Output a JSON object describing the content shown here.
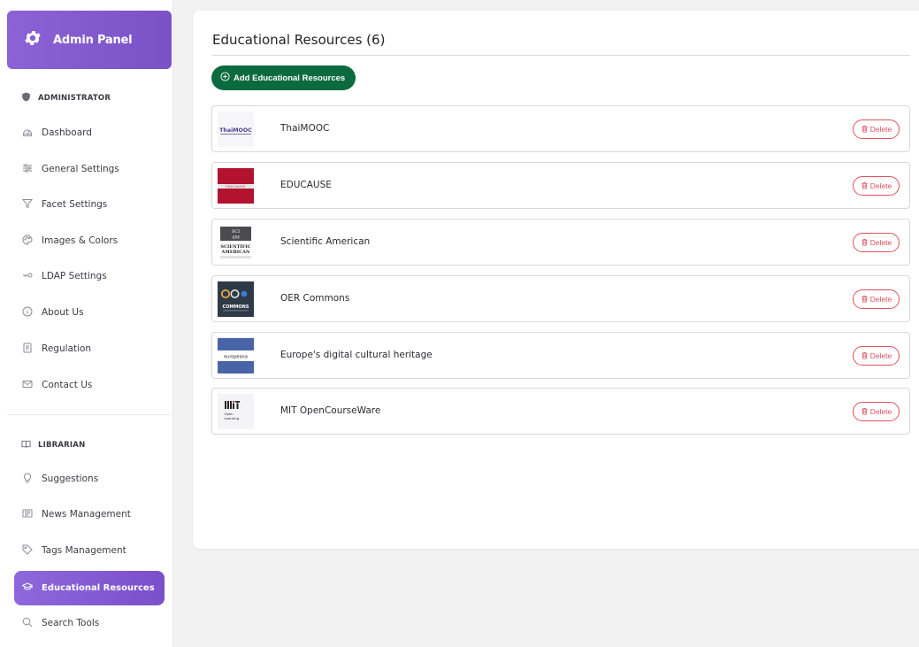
{
  "sidebar": {
    "brand_title": "Admin Panel",
    "sections": [
      {
        "title": "ADMINISTRATOR",
        "icon": "shield-icon"
      },
      {
        "title": "LIBRARIAN",
        "icon": "book-icon"
      }
    ],
    "items": [
      {
        "label": "Dashboard",
        "icon": "gauge-icon"
      },
      {
        "label": "General Settings",
        "icon": "sliders-icon"
      },
      {
        "label": "Facet Settings",
        "icon": "filter-icon"
      },
      {
        "label": "Images & Colors",
        "icon": "palette-icon"
      },
      {
        "label": "LDAP Settings",
        "icon": "key-icon"
      },
      {
        "label": "About Us",
        "icon": "info-icon"
      },
      {
        "label": "Regulation",
        "icon": "document-icon"
      },
      {
        "label": "Contact Us",
        "icon": "envelope-icon"
      },
      {
        "label": "Suggestions",
        "icon": "lightbulb-icon"
      },
      {
        "label": "News Management",
        "icon": "newspaper-icon"
      },
      {
        "label": "Tags Management",
        "icon": "tag-icon"
      },
      {
        "label": "Educational Resources",
        "icon": "graduation-cap-icon",
        "active": true
      },
      {
        "label": "Search Tools",
        "icon": "search-icon"
      }
    ]
  },
  "main": {
    "title": "Educational Resources (6)",
    "add_label": "Add Educational Resources",
    "delete_label": "Delete",
    "resources": [
      {
        "name": "ThaiMOOC",
        "logo_text": "ThaiMOOC"
      },
      {
        "name": "EDUCAUSE",
        "logo_text": "EDUCAUSE"
      },
      {
        "name": "Scientific American",
        "logo_text": "SCIENTIFIC AMERICAN"
      },
      {
        "name": "OER Commons",
        "logo_text": "COMMONS"
      },
      {
        "name": "Europe's digital cultural heritage",
        "logo_text": "europeana"
      },
      {
        "name": "MIT OpenCourseWare",
        "logo_text": "Open Learning"
      }
    ]
  },
  "colors": {
    "accent": "#7b4fc9",
    "add_button": "#0c6b3e",
    "delete": "#e0505e"
  }
}
